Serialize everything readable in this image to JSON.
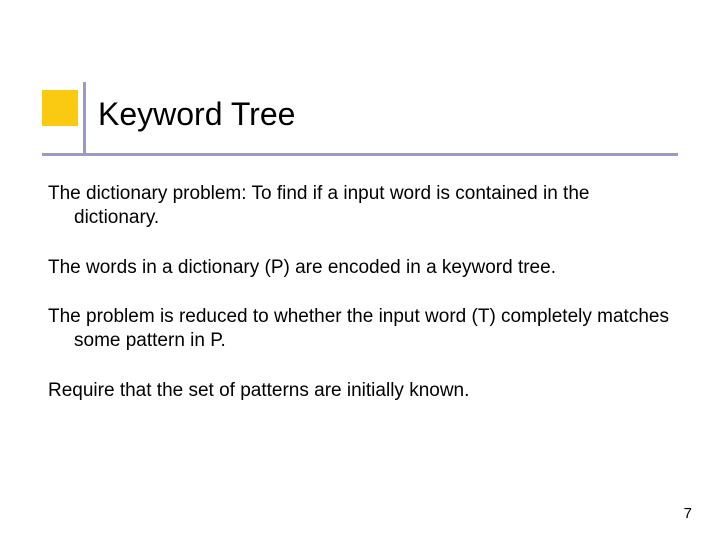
{
  "slide": {
    "title": "Keyword Tree",
    "paragraphs": [
      "The dictionary problem: To find if a input word is contained in the dictionary.",
      "The words in a dictionary (P) are encoded in a keyword tree.",
      "The problem is reduced to whether the input word (T) completely matches some pattern in P.",
      "Require that the set of patterns are initially known."
    ],
    "page_number": "7"
  }
}
